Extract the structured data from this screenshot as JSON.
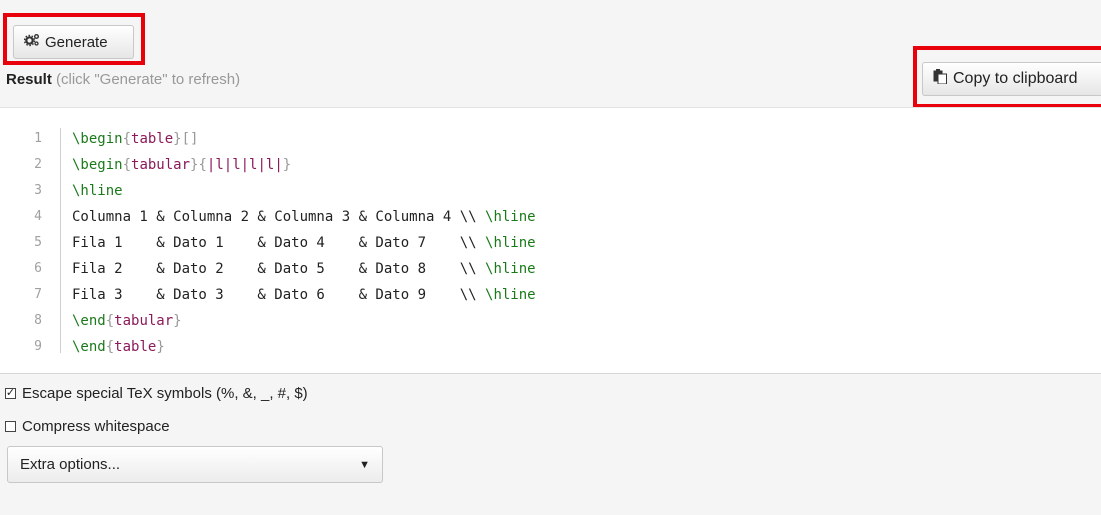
{
  "toolbar": {
    "generate_label": "Generate",
    "generate_icon": "gears-icon"
  },
  "result": {
    "title": "Result",
    "hint": "(click \"Generate\" to refresh)",
    "copy_label": "Copy to clipboard",
    "copy_icon": "clipboard-icon"
  },
  "code": {
    "lines": [
      {
        "num": "1",
        "text": "\\begin{table}[]"
      },
      {
        "num": "2",
        "text": "\\begin{tabular}{|l|l|l|l|}"
      },
      {
        "num": "3",
        "text": "\\hline"
      },
      {
        "num": "4",
        "text": "Columna 1 & Columna 2 & Columna 3 & Columna 4 \\\\ \\hline"
      },
      {
        "num": "5",
        "text": "Fila 1    & Dato 1    & Dato 4    & Dato 7    \\\\ \\hline"
      },
      {
        "num": "6",
        "text": "Fila 2    & Dato 2    & Dato 5    & Dato 8    \\\\ \\hline"
      },
      {
        "num": "7",
        "text": "Fila 3    & Dato 3    & Dato 6    & Dato 9    \\\\ \\hline"
      },
      {
        "num": "8",
        "text": "\\end{tabular}"
      },
      {
        "num": "9",
        "text": "\\end{table}"
      }
    ]
  },
  "options": {
    "escape_label": "Escape special TeX symbols (%, &, _, #, $)",
    "escape_checked": true,
    "compress_label": "Compress whitespace",
    "compress_checked": false,
    "extra_label": "Extra options..."
  },
  "colors": {
    "highlight": "#e8000b",
    "keyword": "#1a7a1a",
    "argument": "#8b1a5a"
  }
}
